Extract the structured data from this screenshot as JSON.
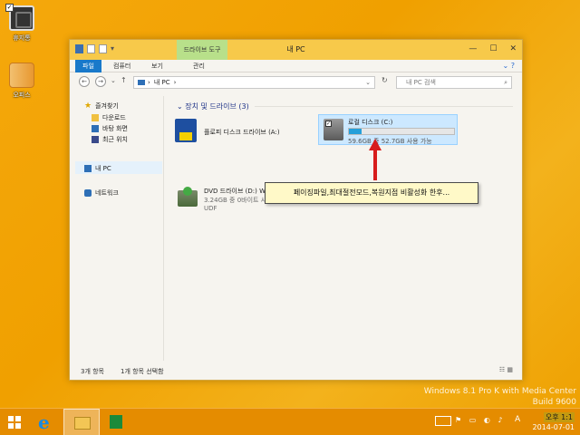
{
  "desktop": {
    "icons": [
      {
        "label": "휴지통"
      },
      {
        "label": "오피스"
      }
    ]
  },
  "window": {
    "title": "내 PC",
    "contextual_tab": "드라이브 도구",
    "ribbon_tabs": [
      "파일",
      "컴퓨터",
      "보기",
      "관리"
    ],
    "address": "내 PC",
    "search_placeholder": "내 PC 검색",
    "group_title": "장치 및 드라이브 (3)",
    "status_items": "3개 항목",
    "status_selected": "1개 항목 선택함"
  },
  "nav": {
    "favorites": "즐겨찾기",
    "downloads": "다운로드",
    "desktop": "바탕 화면",
    "recent": "최근 위치",
    "this_pc": "내 PC",
    "network": "네트워크"
  },
  "drives": {
    "floppy": {
      "name": "플로피 디스크 드라이브 (A:)"
    },
    "dvd": {
      "name": "DVD 드라이브 (D:) Win81",
      "detail": "3.24GB 중 0바이트 사용 가능",
      "fs": "UDF"
    },
    "local": {
      "name": "로컬 디스크 (C:)",
      "size": "59.6GB 중 52.7GB 사용 가능",
      "used_fraction": 0.12
    }
  },
  "callout": "페이징파일,최대절전모드,복원지점 비활성화 한후...",
  "watermark": {
    "line1": "Windows 8.1 Pro K with Media Center",
    "line2": "Build 9600"
  },
  "taskbar": {
    "lang": "A",
    "time": "오후 1:1",
    "date": "2014-07-01"
  },
  "colors": {
    "desktop": "#f0a000",
    "titlebar": "#f7c94a",
    "file_tab": "#1979ca",
    "arrow": "#d71c1c",
    "callout_bg": "#fff9c8",
    "progress": "#26a0da"
  },
  "icon_names": [
    "recycle-bin-icon",
    "office-icon",
    "floppy-drive-icon",
    "dvd-drive-icon",
    "local-disk-icon",
    "start-icon",
    "ie-icon",
    "explorer-icon",
    "store-icon"
  ]
}
